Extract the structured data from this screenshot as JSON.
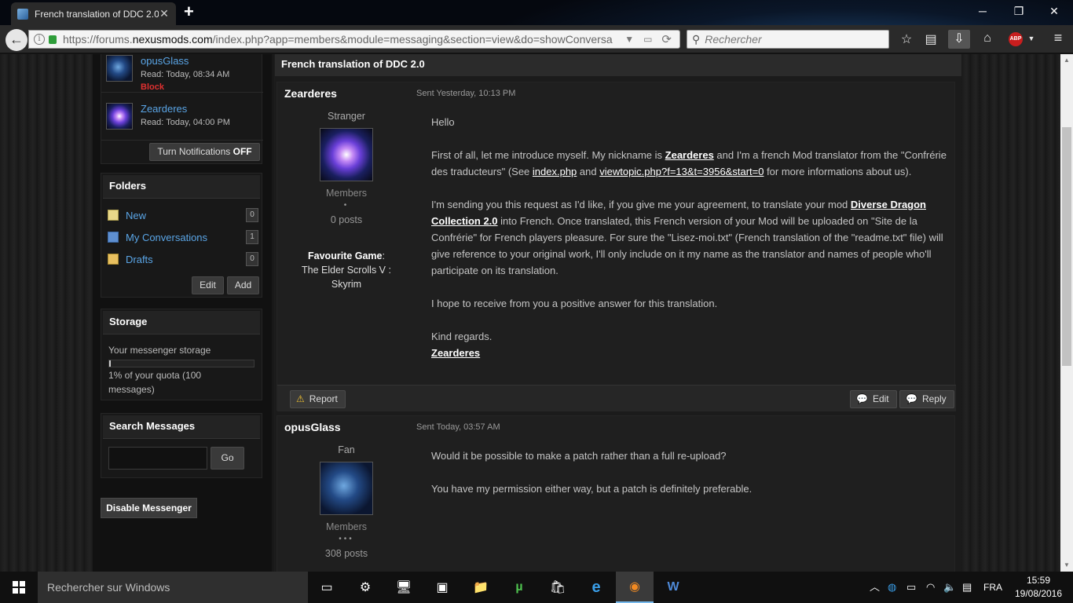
{
  "browser": {
    "tab_title": "French translation of DDC 2.0",
    "tab_close": "✕",
    "new_tab": "+",
    "url_prefix": "https://forums.",
    "url_domain": "nexusmods.com",
    "url_path": "/index.php?app=members&module=messaging&section=view&do=showConversa",
    "search_placeholder": "Rechercher",
    "abp_label": "ABP"
  },
  "sidebar": {
    "participants": [
      {
        "name": "opusGlass",
        "read": "Read: Today, 08:34 AM",
        "block": "Block"
      },
      {
        "name": "Zearderes",
        "read": "Read: Today, 04:00 PM"
      }
    ],
    "notifications_button": "Turn Notifications",
    "notifications_state": "OFF",
    "folders": {
      "title": "Folders",
      "items": [
        {
          "label": "New",
          "count": "0"
        },
        {
          "label": "My Conversations",
          "count": "1"
        },
        {
          "label": "Drafts",
          "count": "0"
        }
      ],
      "edit": "Edit",
      "add": "Add"
    },
    "storage": {
      "title": "Storage",
      "label": "Your messenger storage",
      "percent": 1,
      "quota_line1": "1% of your quota (100",
      "quota_line2": "messages)"
    },
    "search": {
      "title": "Search Messages",
      "go": "Go"
    },
    "disable_button": "Disable Messenger"
  },
  "conversation": {
    "title": "French translation of DDC 2.0",
    "messages": [
      {
        "author": "Zearderes",
        "sent": "Sent Yesterday, 10:13 PM",
        "rank": "Stranger",
        "group": "Members",
        "pips": "•",
        "posts": "0 posts",
        "fav_label": "Favourite Game",
        "fav_line1": "The Elder Scrolls V :",
        "fav_line2": "Skyrim",
        "body": {
          "greeting": "Hello",
          "p1_a": "First of all, let me introduce myself. My nickname is ",
          "p1_name": "Zearderes",
          "p1_b": " and I'm a french Mod translator from the \"Confrérie des traducteurs\" (See ",
          "p1_link1": "index.php",
          "p1_c": " and ",
          "p1_link2": "viewtopic.php?f=13&t=3956&start=0",
          "p1_d": " for more informations about us).",
          "p2_a": "I'm sending you this request as I'd like, if you give me your agreement, to translate your mod ",
          "p2_mod": "Diverse Dragon Collection 2.0",
          "p2_b": " into French. Once translated, this French version of your Mod will be uploaded on \"Site de la Confrérie\" for French players pleasure. For sure the \"Lisez-moi.txt\" (French translation of the \"readme.txt\" file) will give reference to your original work, I'll only include on it my name as the translator and names of people who'll participate on its translation.",
          "p3": "I hope to receive from you a positive answer for this translation.",
          "closing": "Kind regards.",
          "signature": "Zearderes"
        },
        "report": "Report",
        "edit": "Edit",
        "reply": "Reply"
      },
      {
        "author": "opusGlass",
        "sent": "Sent Today, 03:57 AM",
        "rank": "Fan",
        "group": "Members",
        "pips": "•••",
        "posts": "308 posts",
        "body": {
          "p1": "Would it be possible to make a patch rather than a full re-upload?",
          "p2": "You have my permission either way, but a patch is definitely preferable."
        }
      }
    ]
  },
  "taskbar": {
    "search_text": "Rechercher sur Windows",
    "language": "FRA",
    "time": "15:59",
    "date": "19/08/2016"
  }
}
